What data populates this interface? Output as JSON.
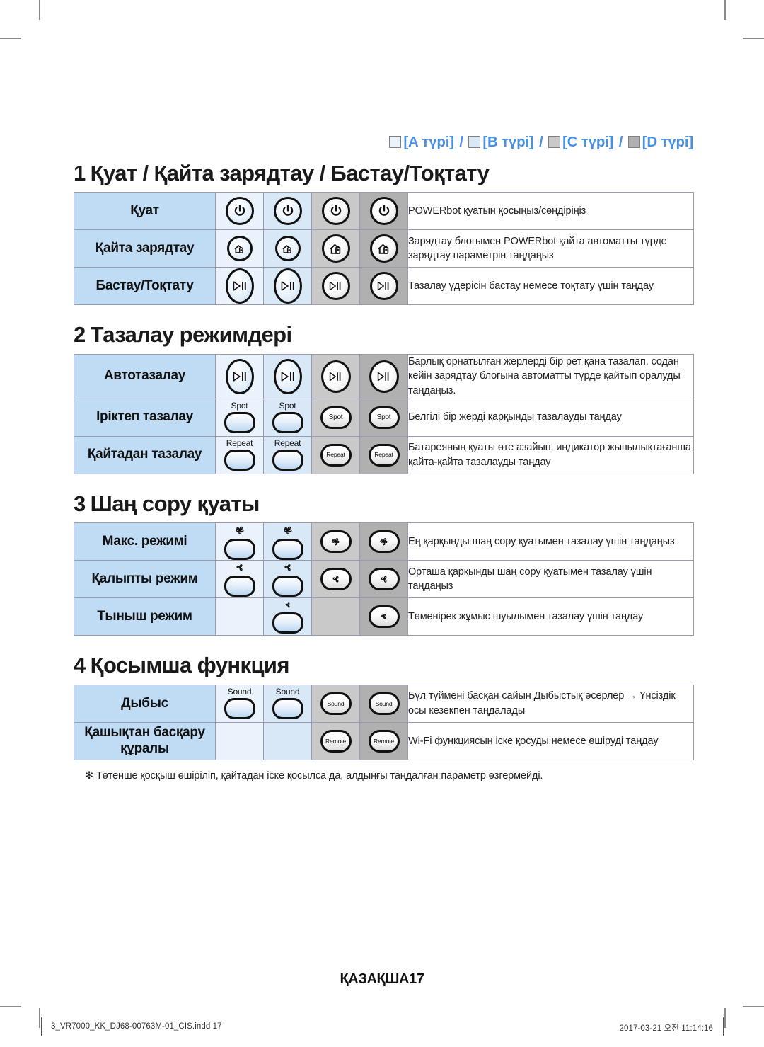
{
  "legend": {
    "items": [
      {
        "swatch_color": "#eaf2fb",
        "label": "[A түрі]"
      },
      {
        "swatch_color": "#d9e8f7",
        "label": "[B түрі]"
      },
      {
        "swatch_color": "#c9c9c9",
        "label": "[C түрі]"
      },
      {
        "swatch_color": "#b0b0b0",
        "label": "[D түрі]"
      }
    ],
    "separator": "/",
    "accent_color": "#4a90e2"
  },
  "sections": [
    {
      "number": "1",
      "title": "Қуат / Қайта зарядтау / Бастау/Тоқтату",
      "rows": [
        {
          "label": "Қуат",
          "icon": "power-icon",
          "types": [
            "a",
            "b",
            "c",
            "d"
          ],
          "desc": "POWERbot қуатын қосыңыз/сөндіріңіз"
        },
        {
          "label": "Қайта зарядтау",
          "icon": "recharge-home-battery-icon",
          "types": [
            "a",
            "b",
            "c",
            "d"
          ],
          "desc": "Зарядтау блогымен POWERbot қайта автоматты түрде зарядтау параметрін таңдаңыз"
        },
        {
          "label": "Бастау/Тоқтату",
          "icon": "play-pause-icon",
          "types": [
            "a",
            "b",
            "c",
            "d"
          ],
          "desc": "Тазалау үдерісін бастау немесе тоқтату үшін таңдау"
        }
      ]
    },
    {
      "number": "2",
      "title": "Тазалау режимдері",
      "rows": [
        {
          "label": "Автотазалау",
          "icon": "play-pause-icon",
          "types": [
            "a",
            "b",
            "c",
            "d"
          ],
          "desc": "Барлық орнатылған жерлерді бір рет қана тазалап, содан кейін зарядтау блогына автоматты түрде қайтып оралуды таңдаңыз."
        },
        {
          "label": "Іріктеп тазалау",
          "icon": "spot-button",
          "caption": "Spot",
          "types": [
            "a",
            "b",
            "c",
            "d"
          ],
          "desc": "Белгілі бір жерді қарқынды тазалауды таңдау"
        },
        {
          "label": "Қайтадан тазалау",
          "icon": "repeat-button",
          "caption": "Repeat",
          "types": [
            "a",
            "b",
            "c",
            "d"
          ],
          "desc": "Батареяның қуаты өте азайып, индикатор жыпылықтағанша қайта-қайта тазалауды таңдау"
        }
      ]
    },
    {
      "number": "3",
      "title": "Шаң сору қуаты",
      "rows": [
        {
          "label": "Макс. режимі",
          "icon": "fan-max-icon",
          "types": [
            "a",
            "b",
            "c",
            "d"
          ],
          "desc": "Ең қарқынды шаң сору қуатымен тазалау үшін таңдаңыз"
        },
        {
          "label": "Қалыпты режим",
          "icon": "fan-normal-icon",
          "types": [
            "a",
            "b",
            "c",
            "d"
          ],
          "desc": "Орташа қарқынды шаң сору қуатымен тазалау үшін таңдаңыз"
        },
        {
          "label": "Тыныш режим",
          "icon": "fan-quiet-icon",
          "types": [
            "b",
            "d"
          ],
          "desc": "Төменірек жұмыс шуылымен тазалау үшін таңдау"
        }
      ]
    },
    {
      "number": "4",
      "title": "Қосымша функция",
      "rows": [
        {
          "label": "Дыбыс",
          "icon": "sound-button",
          "caption": "Sound",
          "types": [
            "a",
            "b",
            "c",
            "d"
          ],
          "desc": "Бұл түймені басқан сайын Дыбыстық әсерлер → Үнсіздік осы кезекпен таңдалады"
        },
        {
          "label": "Қашықтан басқару құралы",
          "icon": "remote-button",
          "caption": "Remote",
          "types": [
            "c",
            "d"
          ],
          "desc": "Wi-Fi функциясын іске қосуды немесе өшіруді таңдау"
        }
      ]
    }
  ],
  "note": "✻ Төтенше қосқыш өшіріліп, қайтадан іске қосылса да, алдыңғы таңдалған параметр өзгермейді.",
  "page_footer": "ҚАЗАҚША17",
  "print_footer": {
    "left": "3_VR7000_KK_DJ68-00763M-01_CIS.indd   17",
    "right": "2017-03-21   오전 11:14:16"
  }
}
